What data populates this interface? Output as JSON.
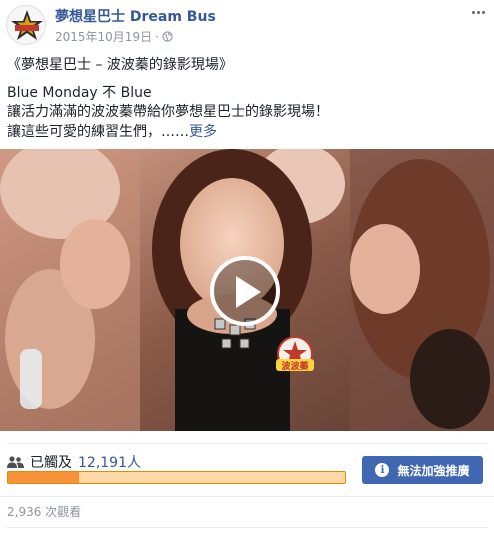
{
  "post": {
    "page_name": "夢想星巴士 Dream Bus",
    "date": "2015年10月19日",
    "separator": "·",
    "privacy_icon": "globe-icon",
    "more_icon": "more-options-icon",
    "text": {
      "title_line": "《夢想星巴士 – 波波蓁的錄影現場》",
      "line1": "Blue Monday 不 Blue",
      "line2": "讓活力滿滿的波波蓁帶給你夢想星巴士的錄影現場！",
      "line3": "讓這些可愛的練習生們，……",
      "see_more": "更多"
    }
  },
  "video": {
    "play_icon": "play-icon",
    "badge_text": "波波蓁"
  },
  "insights": {
    "reach_prefix": "已觸及",
    "reach_count": "12,191人",
    "reach_icon": "people-icon",
    "progress_fraction": 0.21,
    "boost_label": "無法加強推廣",
    "info_icon": "info-icon",
    "views_text": "2,936 次觀看"
  },
  "colors": {
    "link_blue": "#365899",
    "button_blue": "#4267b2",
    "progress_orange": "#f7923a",
    "meta_gray": "#90949c"
  }
}
